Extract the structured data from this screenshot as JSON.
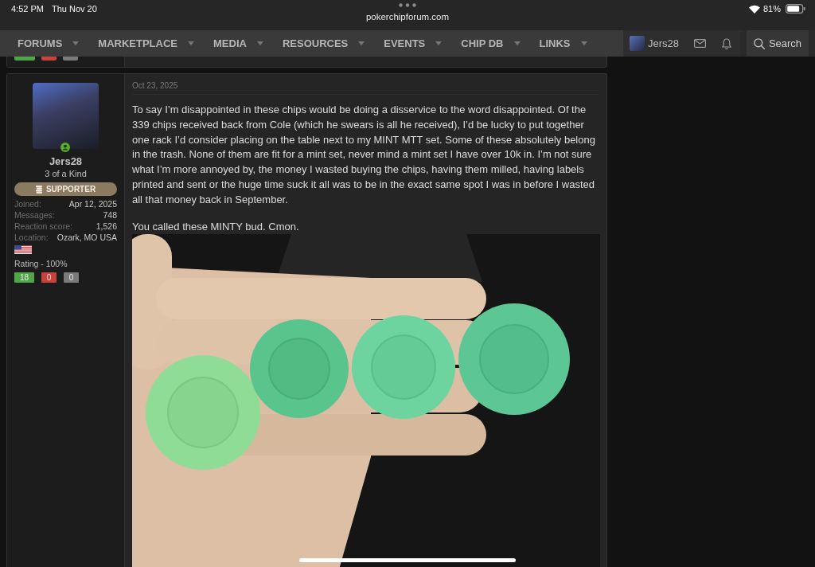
{
  "status_bar": {
    "time": "4:52 PM",
    "date": "Thu Nov 20",
    "url": "pokerchipforum.com",
    "battery": "81%"
  },
  "nav": {
    "items": [
      {
        "label": "FORUMS",
        "dropdown": true
      },
      {
        "label": "MARKETPLACE",
        "dropdown": true
      },
      {
        "label": "MEDIA",
        "dropdown": true
      },
      {
        "label": "RESOURCES",
        "dropdown": true
      },
      {
        "label": "EVENTS",
        "dropdown": true
      },
      {
        "label": "CHIP DB",
        "dropdown": true
      },
      {
        "label": "LINKS",
        "dropdown": true
      }
    ],
    "username": "Jers28",
    "search": "Search"
  },
  "previous_post": {
    "ratings": [
      {
        "kind": "positive"
      },
      {
        "kind": "negative"
      },
      {
        "kind": "neutral"
      }
    ]
  },
  "post": {
    "author": {
      "name": "Jers28",
      "title": "3 of a Kind",
      "online": true,
      "badge": "SUPPORTER",
      "stats": [
        {
          "label": "Joined:",
          "value": "Apr 12, 2025"
        },
        {
          "label": "Messages:",
          "value": "748"
        },
        {
          "label": "Reaction score:",
          "value": "1,526"
        },
        {
          "label": "Location:",
          "value": "Ozark, MO USA"
        }
      ],
      "rating_label": "Rating - 100%",
      "ratings": [
        {
          "kind": "positive",
          "count": "18"
        },
        {
          "kind": "negative",
          "count": "0"
        },
        {
          "kind": "neutral",
          "count": "0"
        }
      ]
    },
    "date": "Oct 23, 2025",
    "paragraphs": [
      "To say I’m disappointed in these chips would be doing a disservice to the word disappointed. Of the 339 chips received back from Cole (which he swears is all he received), I’d be lucky to put together one rack I’d consider placing on the table next to my MINT MTT set. Some of these absolutely belong in the trash. None of them are fit for a mint set, never mind a mint set I have over 10k in. I’m not sure what I’m more annoyed by, the money I wasted buying the chips, having them milled, having labels printed and sent or the huge time suck it all was to be in the exact same spot I was in before I wasted all that money back in September.",
      "You called these MINTY bud. Cmon."
    ]
  }
}
